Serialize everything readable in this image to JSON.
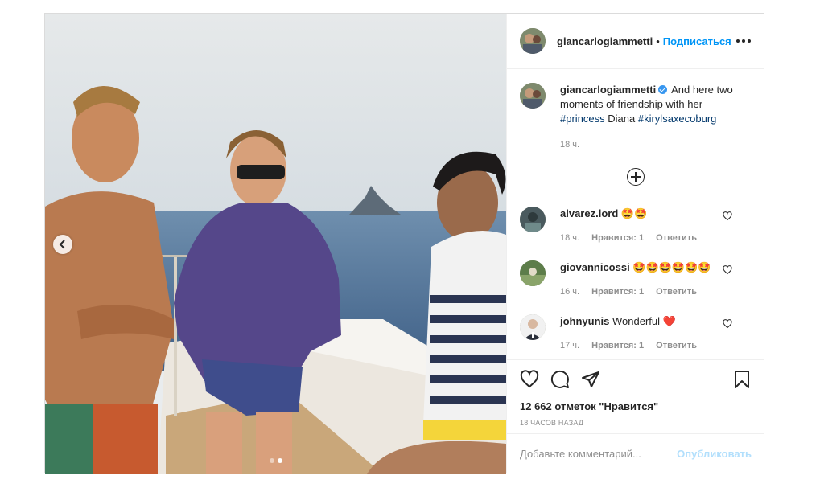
{
  "post": {
    "author": "giancarlogiammetti",
    "separator": "•",
    "follow_label": "Подписаться",
    "more_icon": "more-horizontal-icon",
    "carousel": {
      "prev_icon": "chevron-left-icon",
      "slide_count": 2,
      "active_slide": 2
    }
  },
  "caption": {
    "user": "giancarlogiammetti",
    "verified_icon": "verified-badge-icon",
    "text_before": "And here two moments of friendship with her",
    "hashtag1": "#princess",
    "middle": "Diana",
    "hashtag2": "#kirylsaxecoburg",
    "time": "18 ч."
  },
  "load_more_icon": "plus-circle-icon",
  "comments": [
    {
      "user": "alvarez.lord",
      "text": "🤩🤩",
      "time": "18 ч.",
      "likes": "Нравится: 1",
      "reply": "Ответить"
    },
    {
      "user": "giovannicossi",
      "text": "🤩🤩🤩🤩🤩🤩",
      "time": "16 ч.",
      "likes": "Нравится: 1",
      "reply": "Ответить"
    },
    {
      "user": "johnyunis",
      "text": "Wonderful ❤️",
      "time": "17 ч.",
      "likes": "Нравится: 1",
      "reply": "Ответить"
    }
  ],
  "actions": {
    "like_icon": "heart-icon",
    "comment_icon": "comment-icon",
    "share_icon": "paper-plane-icon",
    "save_icon": "bookmark-icon",
    "likes_text": "12 662 отметок \"Нравится\"",
    "posted_ago": "18 часов назад"
  },
  "add_comment": {
    "placeholder": "Добавьте комментарий...",
    "publish_label": "Опубликовать"
  },
  "colors": {
    "link": "#0095f6",
    "hashtag": "#00376b",
    "muted": "#8e8e8e",
    "publish_disabled": "#b2dffc",
    "heart_red": "#ed4956"
  }
}
